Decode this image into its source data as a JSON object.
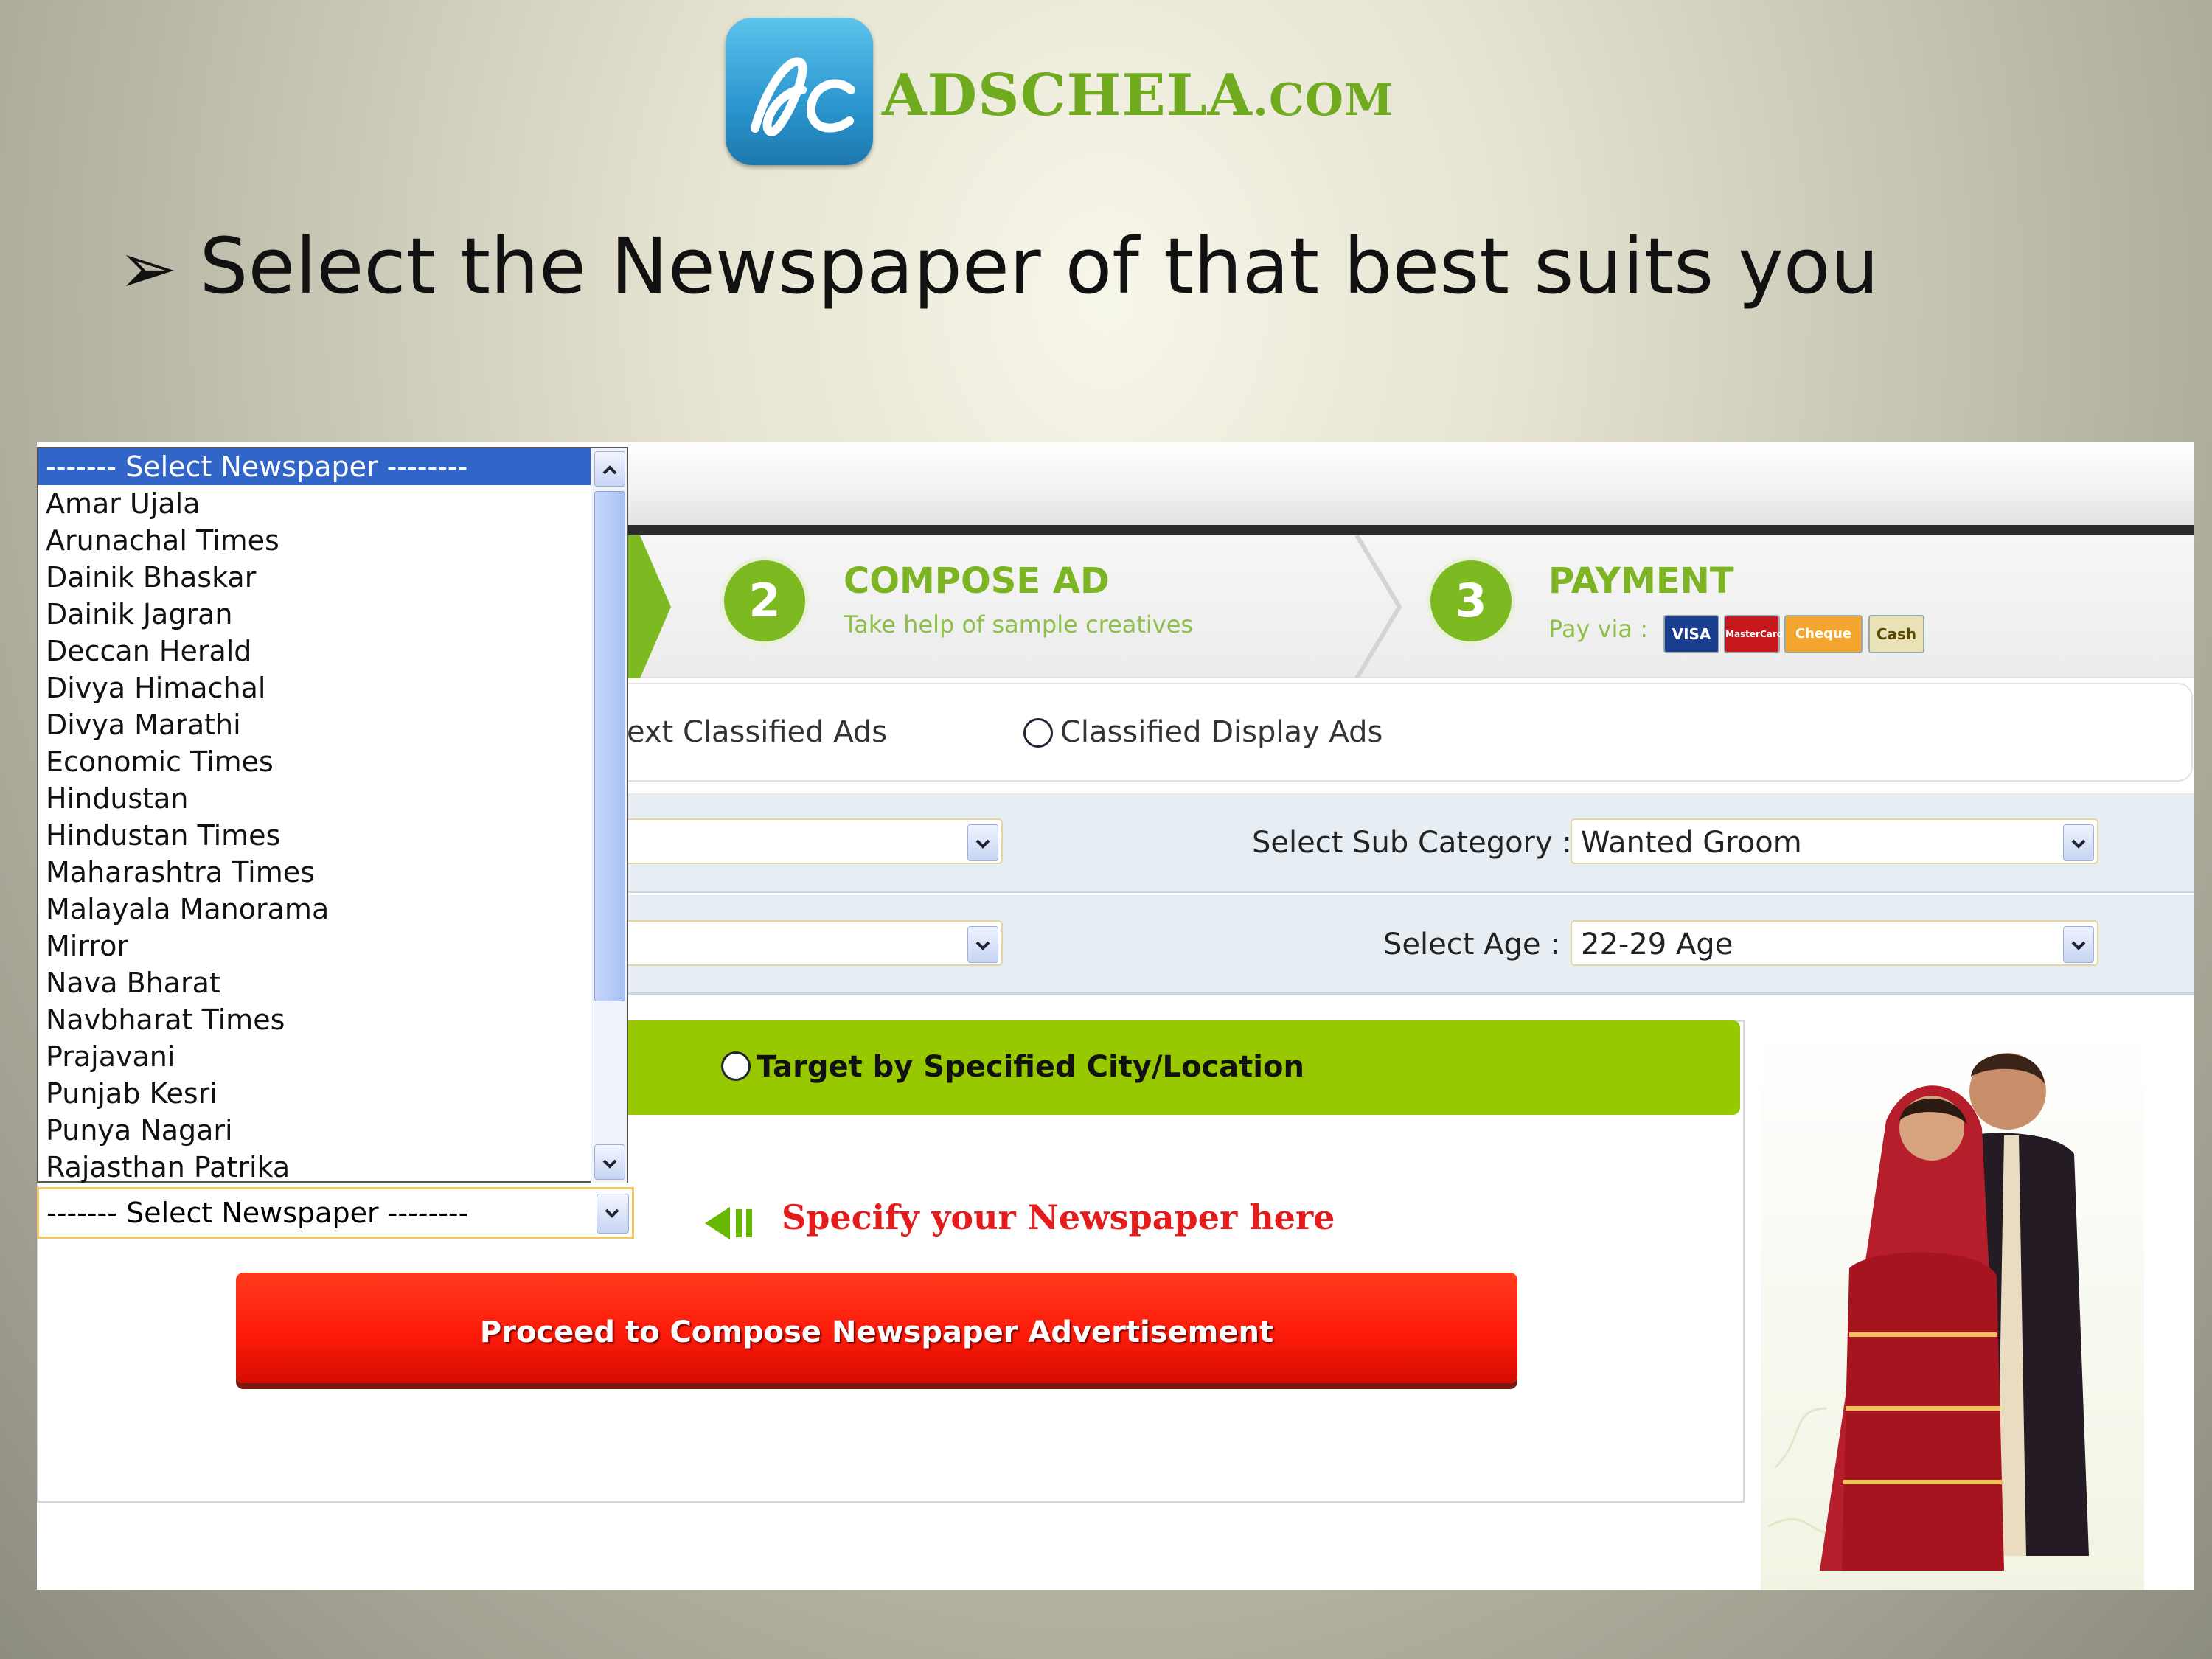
{
  "brand": {
    "logo_mark": "ac",
    "name_main": "ADSCHELA",
    "name_suffix": ".COM",
    "color": "#6faa1f"
  },
  "heading": {
    "bullet": "➢",
    "text": "Select the Newspaper of that best suits you"
  },
  "steps": [
    {
      "number": "2",
      "title": "COMPOSE AD",
      "subtitle": "Take help of sample creatives"
    },
    {
      "number": "3",
      "title": "PAYMENT",
      "subtitle": "Pay via :"
    }
  ],
  "payment_methods": [
    "VISA",
    "MasterCard",
    "Cheque",
    "Cash"
  ],
  "ad_type": {
    "option1": "ext Classified Ads",
    "option2": "Classified Display Ads"
  },
  "filters": {
    "sub_category_label": "Select Sub Category :",
    "sub_category_value": "Wanted Groom",
    "age_label": "Select Age :",
    "age_value": "22-29 Age"
  },
  "targeting": {
    "option": "Target by Specified City/Location"
  },
  "specify_hint": "Specify your Newspaper here",
  "proceed_label": "Proceed to Compose Newspaper Advertisement",
  "newspaper_select": {
    "selected": "------- Select Newspaper --------",
    "options": [
      "------- Select Newspaper --------",
      "Amar Ujala",
      "Arunachal Times",
      "Dainik Bhaskar",
      "Dainik Jagran",
      "Deccan Herald",
      "Divya Himachal",
      "Divya Marathi",
      "Economic Times",
      "Hindustan",
      "Hindustan Times",
      "Maharashtra Times",
      "Malayala Manorama",
      "Mirror",
      "Nava Bharat",
      "Navbharat Times",
      "Prajavani",
      "Punjab Kesri",
      "Punya Nagari",
      "Rajasthan Patrika"
    ]
  },
  "colors": {
    "accent_green": "#7dba22",
    "highlight_blue": "#3265c8",
    "proceed_red": "#ff1b0a",
    "target_green": "#97c800"
  }
}
